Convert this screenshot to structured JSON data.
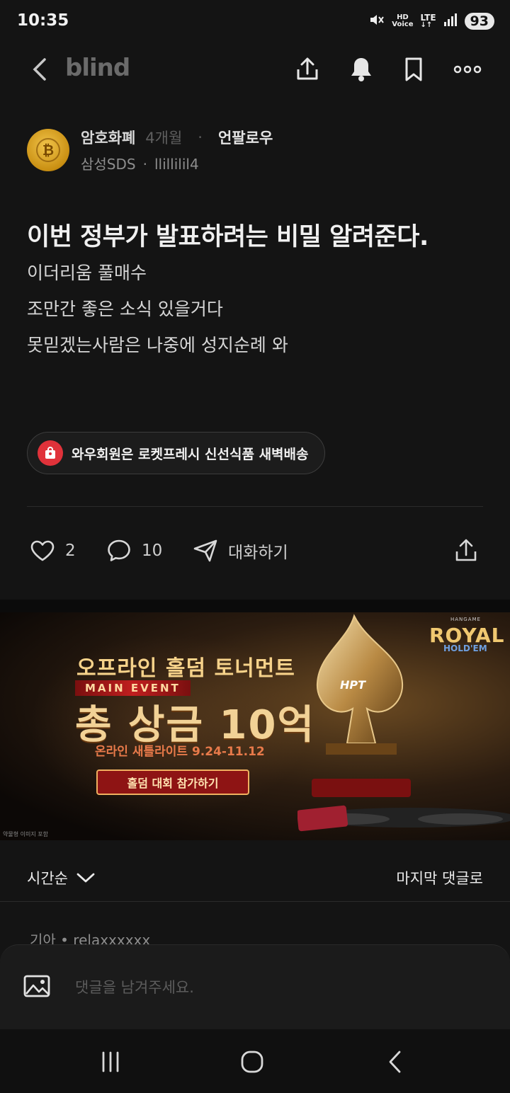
{
  "status_bar": {
    "time": "10:35",
    "hd_label_top": "HD",
    "hd_label_bottom": "Voice",
    "network": "LTE",
    "battery": "93"
  },
  "header": {
    "brand": "blind",
    "icons": [
      "back-icon",
      "share-icon",
      "bell-icon",
      "bookmark-icon",
      "more-icon"
    ]
  },
  "post": {
    "author": {
      "name": "암호화폐",
      "age": "4개월",
      "separator": "·",
      "follow_label": "언팔로우",
      "company": "삼성SDS",
      "sub_separator": "·",
      "nickname": "llillilil4"
    },
    "title": "이번 정부가 발표하려는 비밀 알려준다.",
    "body": [
      "이더리움 풀매수",
      "조만간 좋은 소식 있을거다",
      "못믿겠는사람은 나중에 성지순례 와"
    ]
  },
  "promo": {
    "text": "와우회원은 로켓프레시 신선식품 새벽배송",
    "color": "#e0323a"
  },
  "actions": {
    "likes": "2",
    "comments": "10",
    "chat_label": "대화하기"
  },
  "ad": {
    "brand_small": "HANGAME",
    "brand": "ROYAL",
    "brand_sub": "HOLD'EM",
    "headline": "오프라인 홀덤 토너먼트",
    "event_label": "MAIN EVENT",
    "prize": "총 상금 10억",
    "dates": "온라인 새틀라이트 9.24-11.12",
    "cta": "홀덤 대회 참가하기",
    "fine_print": "약물형 이미지 포함",
    "trophy_text": "HPT"
  },
  "comments_section": {
    "sort_label": "시간순",
    "jump_label": "마지막 댓글로",
    "first_comment_meta": "기아 • relaxxxxxx",
    "input_placeholder": "댓글을 남겨주세요."
  },
  "colors": {
    "background": "#141414",
    "accent_red": "#e0323a"
  }
}
